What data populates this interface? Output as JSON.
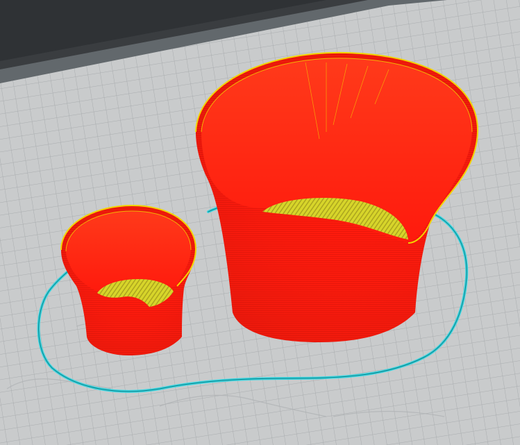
{
  "scene": {
    "colors": {
      "background": "#3a3d40",
      "bed_surface": "#c9cbcc",
      "bed_grid": "#a9acae",
      "bed_edge": "#62686c",
      "outer_wall": "#ff1a0d",
      "outer_wall_shadow": "#c8150a",
      "inner_wall_line": "#f3d400",
      "infill": "#d7d52a",
      "skirt": "#39d5e0",
      "first_layer_ghost": "#b0b3b5"
    },
    "objects": [
      {
        "name": "large-printed-cup",
        "feature": "outer-wall"
      },
      {
        "name": "small-printed-cup",
        "feature": "outer-wall"
      },
      {
        "name": "skirt-outline",
        "feature": "skirt"
      }
    ]
  }
}
